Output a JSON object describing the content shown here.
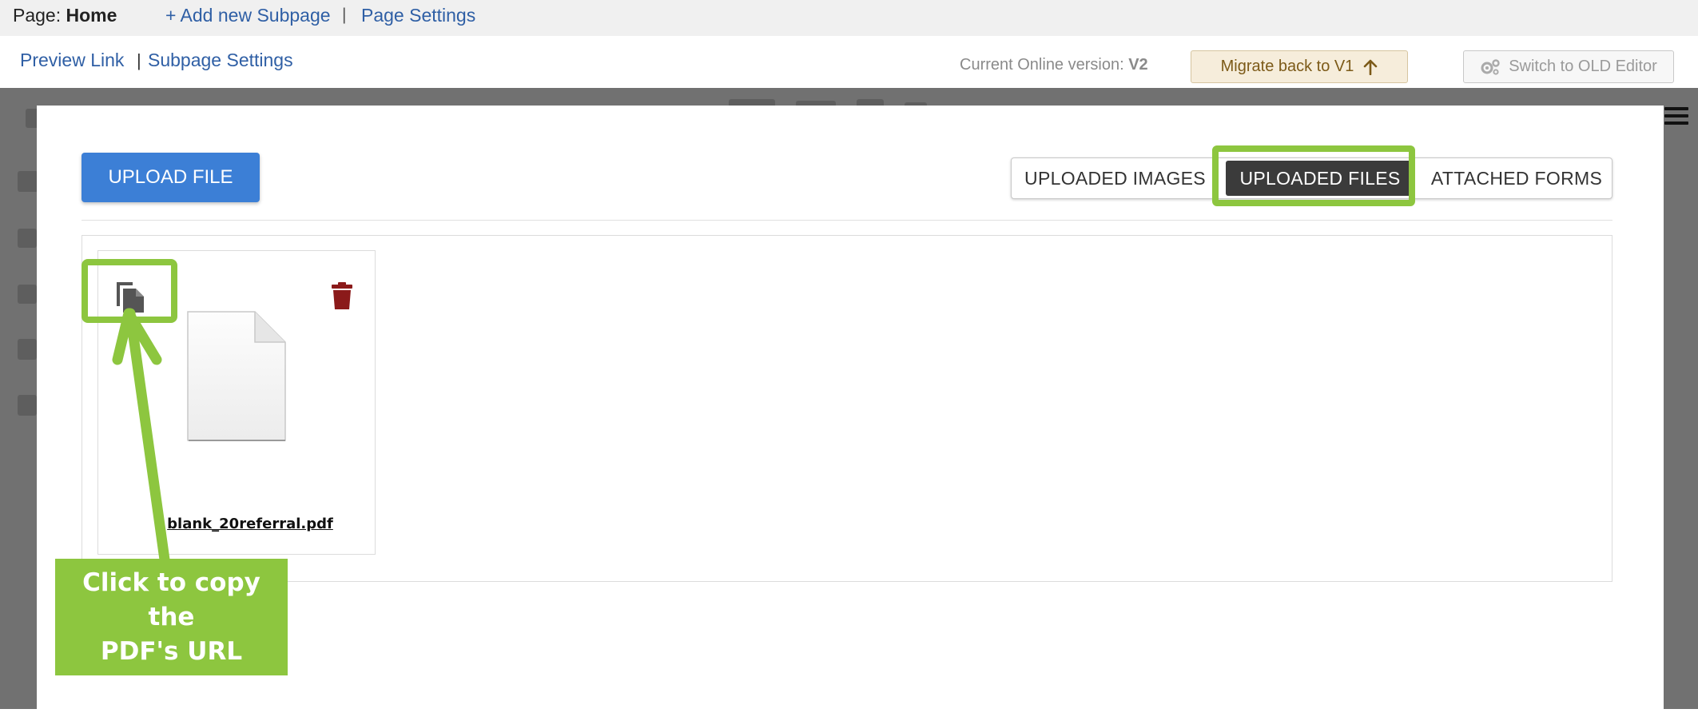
{
  "topbar": {
    "page_prefix": "Page:",
    "page_name": "Home",
    "add_subpage": "+ Add new Subpage",
    "separator": "|",
    "page_settings": "Page Settings"
  },
  "subbar": {
    "preview_link": "Preview Link",
    "separator": "|",
    "subpage_settings": "Subpage Settings",
    "online_version_label": "Current Online version:",
    "online_version_value": "V2",
    "migrate_button": "Migrate back to V1",
    "migrate_icon": "arrow-up-icon",
    "old_editor_button": "Switch to OLD Editor",
    "old_editor_icon": "gears-icon"
  },
  "modal": {
    "upload_button": "UPLOAD FILE",
    "tabs": [
      {
        "label": "UPLOADED IMAGES",
        "active": false
      },
      {
        "label": "UPLOADED FILES",
        "active": true
      },
      {
        "label": "ATTACHED FORMS",
        "active": false
      }
    ],
    "files": [
      {
        "name": "blank_20referral.pdf",
        "icons": [
          "copy-icon",
          "trash-icon",
          "document-icon"
        ]
      }
    ]
  },
  "annotation": {
    "callout_line1": "Click to copy the",
    "callout_line2": "PDF's URL",
    "highlight_color": "#8dc63f"
  },
  "colors": {
    "primary_button": "#3c7fd6",
    "active_tab": "#3b3b3b",
    "link": "#2f5fa5",
    "trash": "#8b1a1a"
  }
}
